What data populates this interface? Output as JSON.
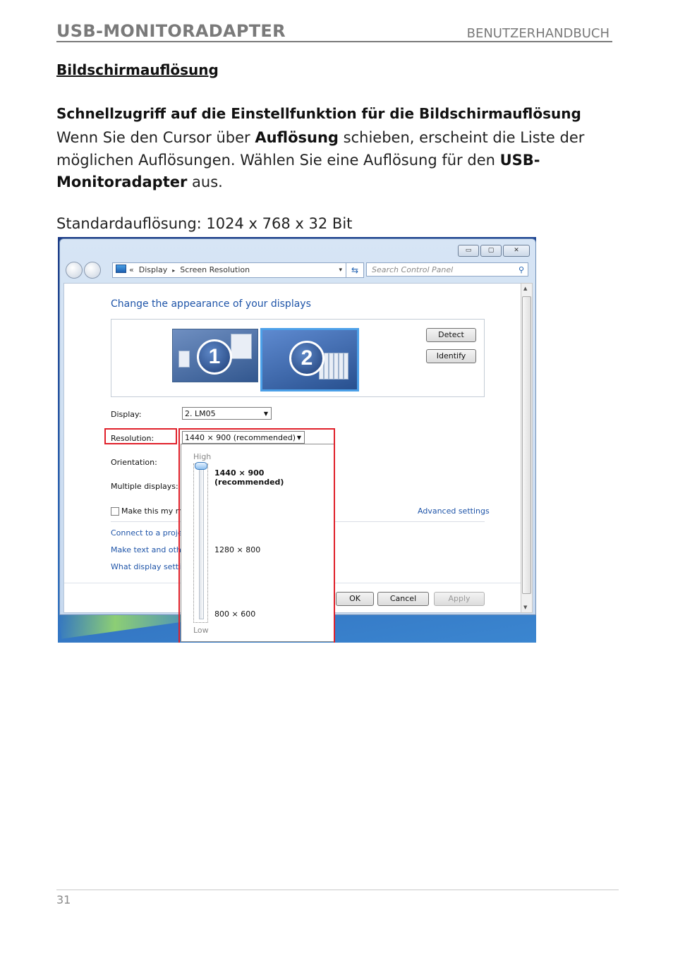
{
  "header": {
    "title": "USB-MONITORADAPTER",
    "right": "BENUTZERHANDBUCH"
  },
  "section_title": "Bildschirmauflösung",
  "subheading": "Schnellzugriff auf die Einstellfunktion für die Bildschirmauflösung",
  "paragraph": {
    "t1": "Wenn Sie den Cursor über ",
    "b1": "Auflösung",
    "t2": " schieben, erscheint die Liste der möglichen Auflösungen. Wählen Sie eine Auflösung für den ",
    "b2": "USB-Monitoradapter",
    "t3": " aus."
  },
  "standard_resolution": "Standardauflösung: 1024 x 768 x 32 Bit",
  "screenshot": {
    "window_buttons": {
      "minimize": "▭",
      "maximize": "▢",
      "close": "✕"
    },
    "address": {
      "prefix": "«",
      "item1": "Display",
      "sep": "▸",
      "item2": "Screen Resolution",
      "dropdown": "▾"
    },
    "refresh": "⇆",
    "search_placeholder": "Search Control Panel",
    "search_icon": "⚲",
    "heading": "Change the appearance of your displays",
    "monitors": {
      "m1": "1",
      "m2": "2"
    },
    "buttons": {
      "detect": "Detect",
      "identify": "Identify",
      "ok": "OK",
      "cancel": "Cancel",
      "apply": "Apply"
    },
    "labels": {
      "display": "Display:",
      "resolution": "Resolution:",
      "orientation": "Orientation:",
      "multiple": "Multiple displays:",
      "make_main": "Make this my m"
    },
    "display_value": "2. LM05",
    "resolution_value": "1440 × 900 (recommended)",
    "links": {
      "advanced": "Advanced settings",
      "connect": "Connect to a projec",
      "make_text": "Make text and othe",
      "what_display": "What display settin"
    },
    "dropdown": {
      "high": "High",
      "low": "Low",
      "options": [
        "1440 × 900 (recommended)",
        "1280 × 800",
        "800 × 600"
      ],
      "selected_level": 1.0
    }
  },
  "page_number": "31",
  "colors": {
    "header_gray": "#7a7a7a",
    "highlight_red": "#e0202a",
    "link_blue": "#1e54a8"
  }
}
